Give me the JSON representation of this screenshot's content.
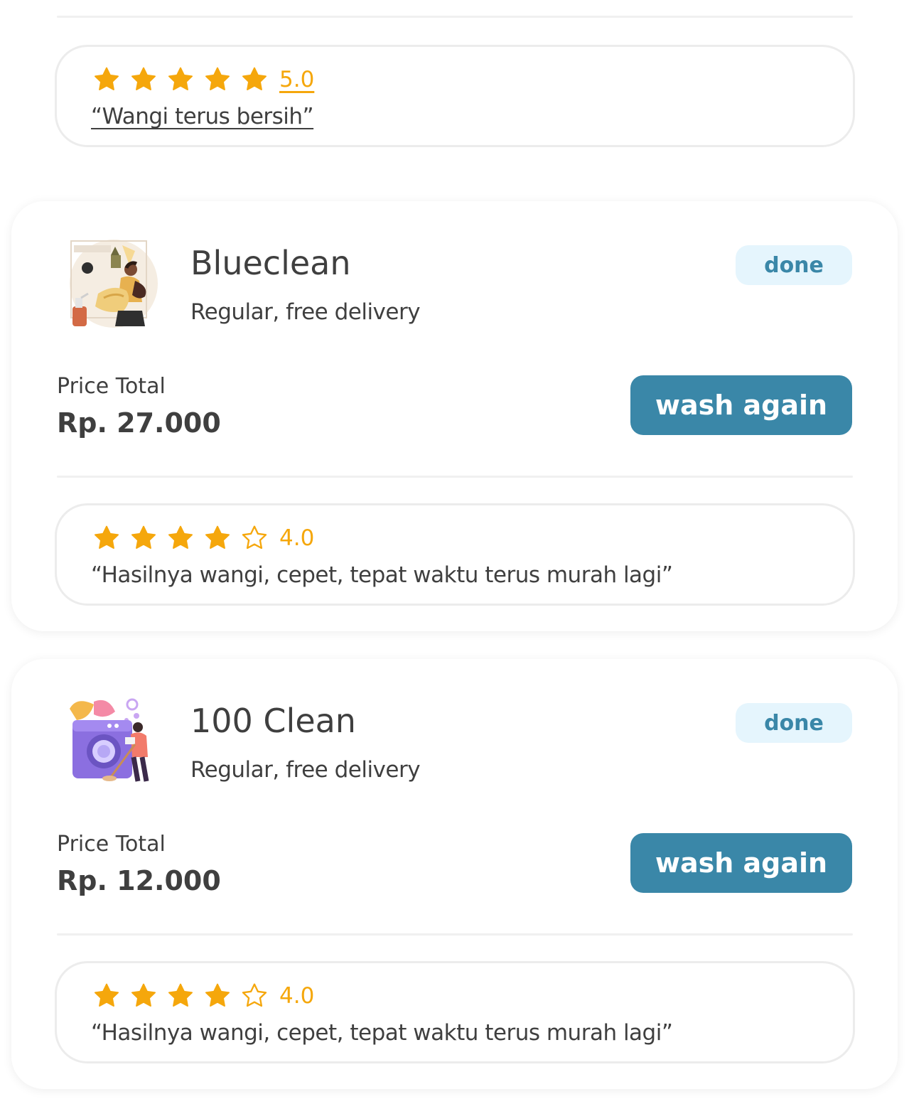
{
  "top_review": {
    "rating": 5,
    "rating_label": "5.0",
    "text": "“Wangi terus bersih”"
  },
  "orders": [
    {
      "shop_name": "Blueclean",
      "service": "Regular, free delivery",
      "status": "done",
      "price_label": "Price Total",
      "price": "Rp. 27.000",
      "action_label": "wash again",
      "illustration": "laundry-person-illustration",
      "review": {
        "rating": 4,
        "rating_label": "4.0",
        "text": "“Hasilnya wangi, cepet, tepat waktu terus murah lagi”"
      }
    },
    {
      "shop_name": "100 Clean",
      "service": "Regular, free delivery",
      "status": "done",
      "price_label": "Price Total",
      "price": "Rp. 12.000",
      "action_label": "wash again",
      "illustration": "washing-machine-illustration",
      "review": {
        "rating": 4,
        "rating_label": "4.0",
        "text": "“Hasilnya wangi, cepet, tepat waktu terus murah lagi”"
      }
    }
  ],
  "colors": {
    "accent": "#3a87a8",
    "badge_bg": "#e5f5fd",
    "star": "#f5a70c",
    "text": "#3f3f3f",
    "border": "#ececec"
  }
}
